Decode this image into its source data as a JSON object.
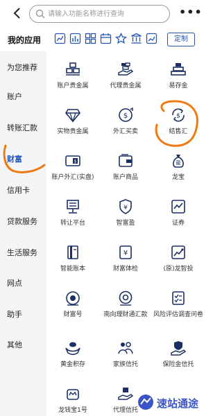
{
  "header": {
    "search_placeholder": "请输入功能名称进行查询"
  },
  "my_apps": {
    "title": "我的应用",
    "customize_label": "定制",
    "icons": [
      "chart-icon",
      "bars-icon",
      "grid-icon",
      "calendar-icon",
      "star-icon",
      "building-icon",
      "chart-icon"
    ]
  },
  "sidebar": {
    "items": [
      {
        "label": "为您推荐"
      },
      {
        "label": "账户"
      },
      {
        "label": "转账汇款"
      },
      {
        "label": "财富"
      },
      {
        "label": "信用卡"
      },
      {
        "label": "贷款服务"
      },
      {
        "label": "生活服务"
      },
      {
        "label": "网点"
      },
      {
        "label": "助手"
      },
      {
        "label": "其他"
      }
    ]
  },
  "grid": {
    "items": [
      {
        "label": "账户贵金属",
        "icon": "gold-bars-icon"
      },
      {
        "label": "代理贵金属",
        "icon": "hand-gold-icon"
      },
      {
        "label": "易存金",
        "icon": "gold-stack-icon"
      },
      {
        "label": "实物贵金属",
        "icon": "diamond-icon"
      },
      {
        "label": "外汇买卖",
        "icon": "exchange-coin-icon"
      },
      {
        "label": "结售汇",
        "icon": "currency-cycle-icon"
      },
      {
        "label": "账户外汇(实盘)",
        "icon": "card-fx-icon"
      },
      {
        "label": "账户商品",
        "icon": "wallet-icon"
      },
      {
        "label": "龙宝",
        "icon": "money-bag-icon"
      },
      {
        "label": "转让平台",
        "icon": "transfer-icon"
      },
      {
        "label": "智富盈",
        "icon": "shield-yen-icon"
      },
      {
        "label": "证券",
        "icon": "stock-chart-icon"
      },
      {
        "label": "智能账本",
        "icon": "ledger-icon"
      },
      {
        "label": "财富体检",
        "icon": "yen-doc-icon"
      },
      {
        "label": "(原)龙智投",
        "icon": "growth-icon"
      },
      {
        "label": "财富号",
        "icon": "target-icon"
      },
      {
        "label": "南向理财通汇款",
        "icon": "coin-disc-icon"
      },
      {
        "label": "风险评估调查问卷",
        "icon": "checklist-icon"
      },
      {
        "label": "黄金积存",
        "icon": "ingot-icon"
      },
      {
        "label": "家族信托",
        "icon": "family-icon"
      },
      {
        "label": "保险金信托",
        "icon": "hand-shield-icon"
      },
      {
        "label": "龙钱宝1号",
        "icon": "crown-badge-icon"
      },
      {
        "label": "代理信托",
        "icon": "hand-box-icon"
      }
    ]
  },
  "watermark": {
    "text": "速站通途"
  },
  "colors": {
    "primary": "#2456b8",
    "annotation": "#f07a12",
    "sidebar_bg": "#f4f5f7"
  }
}
